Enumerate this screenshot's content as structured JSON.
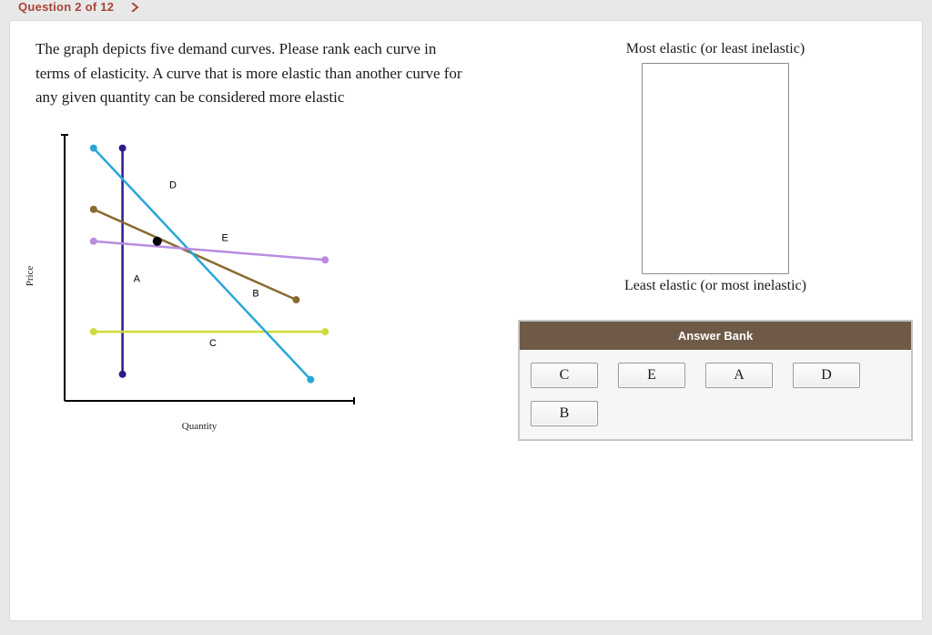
{
  "breadcrumb": "Question 2 of 12",
  "prompt": "The graph depicts five demand curves. Please rank each curve in terms of elasticity. A curve that is more elastic than another curve for any given quantity can be considered more elastic",
  "rank": {
    "top_label": "Most elastic (or least inelastic)",
    "bottom_label": "Least elastic (or most inelastic)"
  },
  "answer_bank": {
    "title": "Answer Bank",
    "items": [
      "C",
      "E",
      "A",
      "D",
      "B"
    ]
  },
  "chart_data": {
    "type": "line",
    "title": "",
    "xlabel": "Quantity",
    "ylabel": "Price",
    "xlim": [
      0,
      10
    ],
    "ylim": [
      0,
      10
    ],
    "series": [
      {
        "name": "A",
        "color": "#2e1a8f",
        "x": [
          2,
          2
        ],
        "y": [
          1.0,
          9.5
        ]
      },
      {
        "name": "B",
        "color": "#8a6a2f",
        "x": [
          1,
          8
        ],
        "y": [
          7.2,
          3.8
        ]
      },
      {
        "name": "C",
        "color": "#cddc39",
        "x": [
          1,
          9
        ],
        "y": [
          2.6,
          2.6
        ]
      },
      {
        "name": "D",
        "color": "#29a7d9",
        "x": [
          1,
          8.5
        ],
        "y": [
          9.5,
          0.8
        ]
      },
      {
        "name": "E",
        "color": "#b98ce0",
        "x": [
          1,
          9
        ],
        "y": [
          6.0,
          5.3
        ]
      }
    ],
    "intersection": {
      "x": 3.2,
      "y": 6.0
    },
    "label_positions": {
      "A": {
        "x": 2.0,
        "y": 4.6,
        "dx": 12,
        "dy": 4
      },
      "B": {
        "x": 6.3,
        "y": 4.4,
        "dx": 6,
        "dy": 14
      },
      "C": {
        "x": 5.0,
        "y": 2.6,
        "dx": 0,
        "dy": 16
      },
      "D": {
        "x": 3.3,
        "y": 8.0,
        "dx": 10,
        "dy": 0
      },
      "E": {
        "x": 5.3,
        "y": 5.8,
        "dx": 4,
        "dy": -6
      }
    }
  }
}
